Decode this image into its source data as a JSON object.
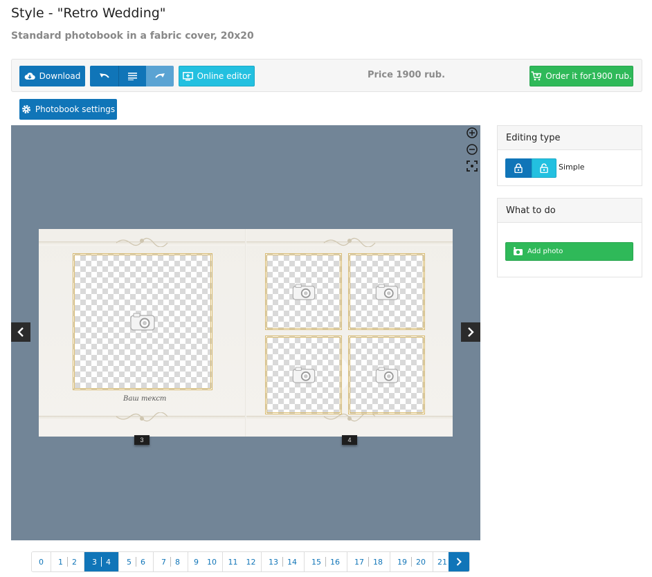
{
  "header": {
    "title": "Style - \"Retro Wedding\"",
    "subtitle": "Standard photobook in a fabric cover, 20x20"
  },
  "toolbar": {
    "download_label": "Download",
    "online_editor_label": "Online editor",
    "price": "Price 1900 rub.",
    "order_label": "Order it for1900 rub.",
    "settings_label": "Photobook settings"
  },
  "spread": {
    "left_text": "Ваш текст",
    "left_page_number": "3",
    "right_page_number": "4"
  },
  "editing_panel": {
    "title": "Editing type",
    "mode_label": "Simple"
  },
  "todo_panel": {
    "title": "What to do",
    "add_photo_label": "Add photo"
  },
  "pager": {
    "pages": [
      {
        "a": "0",
        "b": ""
      },
      {
        "a": "1",
        "b": "2"
      },
      {
        "a": "3",
        "b": "4"
      },
      {
        "a": "5",
        "b": "6"
      },
      {
        "a": "7",
        "b": "8"
      },
      {
        "a": "9",
        "b": "10"
      },
      {
        "a": "11",
        "b": "12"
      },
      {
        "a": "13",
        "b": "14"
      },
      {
        "a": "15",
        "b": "16"
      },
      {
        "a": "17",
        "b": "18"
      },
      {
        "a": "19",
        "b": "20"
      },
      {
        "a": "21",
        "b": ""
      }
    ],
    "active_index": 2
  },
  "colors": {
    "primary": "#1075b8",
    "cyan": "#23c0e0",
    "green": "#2fb959",
    "canvas_bg": "#728597"
  }
}
